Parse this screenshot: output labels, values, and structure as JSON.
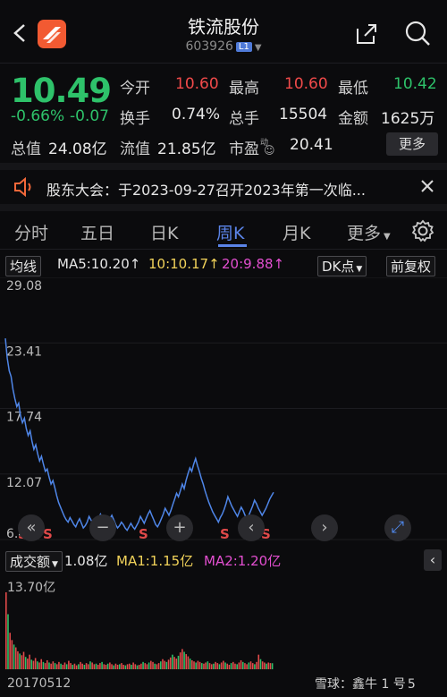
{
  "header": {
    "title": "铁流股份",
    "code": "603926",
    "badge": "L1"
  },
  "quote": {
    "price": "10.49",
    "change_pct": "-0.66%",
    "change": "-0.07",
    "stats": [
      {
        "label": "今开",
        "value": "10.60",
        "color": "#f04a4a"
      },
      {
        "label": "最高",
        "value": "10.60",
        "color": "#f04a4a"
      },
      {
        "label": "最低",
        "value": "10.42",
        "color": "#2ec26a"
      },
      {
        "label": "换手",
        "value": "0.74%",
        "color": "#e8e8e8"
      },
      {
        "label": "总手",
        "value": "15504",
        "color": "#e8e8e8"
      },
      {
        "label": "金额",
        "value": "1625万",
        "color": "#e8e8e8"
      }
    ],
    "total_value_label": "总值",
    "total_value": "24.08亿",
    "float_value_label": "流值",
    "float_value": "21.85亿",
    "pe_label": "市盈",
    "pe_sup": "动",
    "pe_value": "20.41",
    "more_label": "更多"
  },
  "notice": {
    "text": "股东大会：于2023-09-27召开2023年第一次临..."
  },
  "tabs": [
    {
      "label": "分时"
    },
    {
      "label": "五日"
    },
    {
      "label": "日K"
    },
    {
      "label": "周K"
    },
    {
      "label": "月K"
    },
    {
      "label": "更多"
    }
  ],
  "indicators": {
    "ma_label": "均线",
    "ma5": "MA5:10.20↑",
    "ma10": "10:10.17↑",
    "ma20": "20:9.88↑",
    "dk_label": "DK点",
    "adjust_label": "前复权",
    "colors": {
      "ma5": "#e6e6e6",
      "ma10": "#f2d35a",
      "ma20": "#e34fd0"
    }
  },
  "volume": {
    "label": "成交额",
    "value": "1.08亿",
    "ma1": "MA1:1.15亿",
    "ma2": "MA2:1.20亿",
    "axis_max": "13.70亿"
  },
  "footer": {
    "start_date": "20170512",
    "watermark": "雪球：鑫牛 1 号",
    "watermark_tail": "5"
  },
  "chart_data": {
    "type": "line",
    "y_ticks": [
      "29.08",
      "23.41",
      "17.74",
      "12.07",
      "6.40"
    ],
    "ylim": [
      6.4,
      29.08
    ],
    "x_start_label": "20170512",
    "series": [
      {
        "values": [
          23.8,
          22.1,
          21.0,
          20.5,
          19.4,
          18.6,
          17.9,
          18.2,
          17.1,
          16.5,
          16.9,
          16.0,
          15.4,
          15.8,
          14.9,
          14.2,
          14.6,
          13.8,
          13.2,
          13.6,
          12.9,
          12.3,
          12.5,
          11.8,
          11.2,
          11.5,
          10.9,
          10.2,
          9.6,
          9.2,
          8.8,
          8.4,
          8.1,
          7.9,
          8.3,
          8.0,
          7.7,
          7.5,
          7.9,
          8.2,
          7.8,
          7.4,
          7.6,
          7.9,
          8.4,
          8.1,
          7.8,
          7.5,
          7.9,
          8.3,
          8.6,
          8.2,
          7.9,
          7.6,
          7.8,
          8.2,
          8.5,
          8.1,
          7.7,
          7.4,
          7.6,
          7.9,
          7.7,
          7.4,
          7.2,
          7.5,
          7.8,
          7.5,
          7.3,
          7.6,
          7.9,
          8.4,
          8.1,
          7.8,
          8.2,
          8.6,
          8.9,
          8.5,
          8.1,
          7.7,
          7.5,
          7.8,
          8.2,
          8.6,
          9.1,
          8.8,
          8.5,
          8.9,
          9.4,
          9.9,
          10.4,
          10.1,
          10.6,
          11.2,
          10.8,
          11.5,
          12.1,
          12.6,
          12.3,
          12.9,
          13.4,
          12.8,
          12.3,
          11.7,
          11.2,
          10.6,
          10.1,
          9.6,
          9.2,
          8.8,
          8.5,
          8.2,
          7.9,
          8.3,
          8.6,
          9.0,
          9.5,
          10.1,
          9.7,
          9.3,
          9.0,
          8.7,
          8.4,
          8.8,
          9.2,
          8.9,
          8.5,
          8.2,
          8.5,
          8.9,
          9.3,
          9.8,
          9.5,
          9.1,
          8.8,
          8.5,
          8.8,
          9.1,
          9.5,
          9.9,
          10.2,
          10.49
        ],
        "color": "#4f86e8"
      }
    ],
    "volume_values": [
      13.7,
      9.8,
      6.5,
      5.2,
      4.4,
      3.9,
      3.2,
      2.8,
      2.5,
      3.1,
      2.2,
      1.9,
      2.6,
      1.7,
      1.5,
      2.0,
      1.4,
      1.2,
      1.8,
      1.3,
      1.1,
      1.6,
      1.2,
      1.0,
      1.4,
      1.1,
      0.9,
      1.3,
      1.0,
      0.8,
      1.2,
      0.9,
      1.5,
      1.1,
      0.8,
      1.0,
      0.7,
      0.9,
      1.3,
      1.0,
      0.8,
      1.1,
      0.9,
      1.4,
      1.2,
      0.9,
      1.0,
      0.8,
      1.1,
      1.3,
      0.9,
      0.8,
      1.0,
      1.2,
      0.9,
      0.7,
      1.0,
      0.8,
      0.9,
      1.1,
      0.8,
      0.7,
      0.9,
      1.0,
      0.8,
      1.2,
      0.9,
      0.7,
      0.8,
      1.0,
      1.3,
      1.1,
      0.9,
      1.2,
      1.5,
      1.3,
      1.0,
      0.9,
      1.1,
      1.4,
      1.8,
      1.5,
      1.3,
      1.7,
      2.1,
      2.6,
      2.2,
      1.9,
      2.4,
      3.0,
      3.6,
      3.1,
      2.7,
      2.3,
      1.9,
      1.6,
      1.4,
      1.2,
      1.5,
      1.3,
      1.1,
      1.0,
      1.2,
      1.4,
      1.1,
      0.9,
      1.0,
      1.3,
      1.1,
      0.9,
      1.2,
      1.5,
      1.2,
      1.0,
      0.8,
      1.1,
      1.3,
      1.0,
      0.9,
      1.2,
      1.6,
      1.3,
      1.1,
      0.9,
      1.2,
      1.4,
      1.1,
      0.9,
      1.3,
      2.6,
      1.8,
      1.4,
      1.2,
      1.0,
      1.2,
      1.1,
      1.08
    ],
    "dk_marks": [
      "S",
      "S",
      "S",
      "S",
      "S",
      "S",
      "S"
    ]
  }
}
